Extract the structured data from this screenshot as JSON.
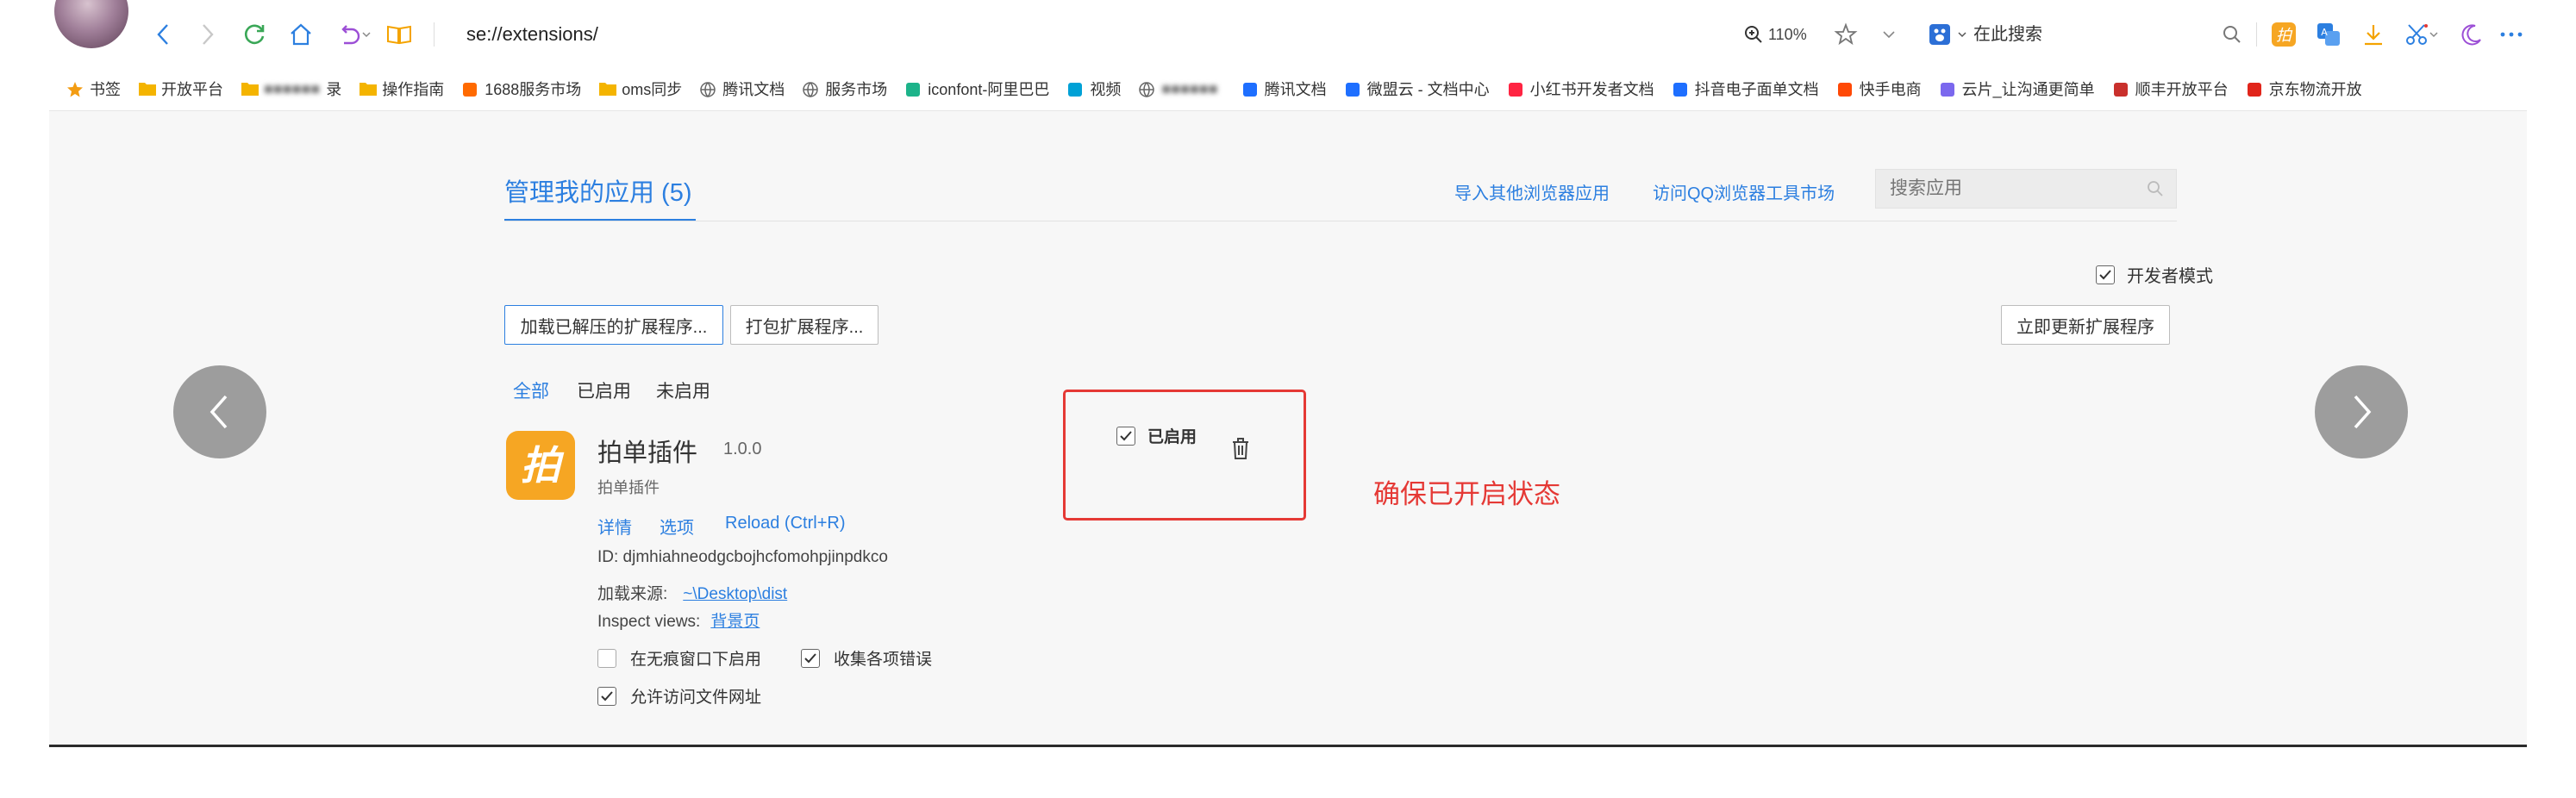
{
  "browser": {
    "url": "se://extensions/",
    "zoom": "110%",
    "search_engine_label": "在此搜索"
  },
  "bookmarks": [
    {
      "label": "书签",
      "icon": "star-icon",
      "color": "#f39c12"
    },
    {
      "label": "开放平台",
      "icon": "folder-icon",
      "color": "#f4b400"
    },
    {
      "label": "录",
      "icon": "folder-icon",
      "color": "#f4b400",
      "blurred": true
    },
    {
      "label": "操作指南",
      "icon": "folder-icon",
      "color": "#f4b400"
    },
    {
      "label": "1688服务市场",
      "icon": "1688-icon",
      "color": "#ff6a00"
    },
    {
      "label": "oms同步",
      "icon": "folder-icon",
      "color": "#f4b400"
    },
    {
      "label": "腾讯文档",
      "icon": "globe-icon",
      "color": "#666666"
    },
    {
      "label": "服务市场",
      "icon": "globe-icon",
      "color": "#666666"
    },
    {
      "label": "iconfont-阿里巴巴",
      "icon": "iconfont-icon",
      "color": "#1db38a"
    },
    {
      "label": "视频",
      "icon": "bilibili-icon",
      "color": "#00a1d6"
    },
    {
      "label": "",
      "icon": "globe-icon",
      "color": "#666666",
      "blurred": true
    },
    {
      "label": "腾讯文档",
      "icon": "tencent-docs-icon",
      "color": "#1e6fff"
    },
    {
      "label": "微盟云 - 文档中心",
      "icon": "weimob-icon",
      "color": "#1e6fff"
    },
    {
      "label": "小红书开发者文档",
      "icon": "xiaohongshu-icon",
      "color": "#ff2442"
    },
    {
      "label": "抖音电子面单文档",
      "icon": "doc-icon",
      "color": "#1e6fff"
    },
    {
      "label": "快手电商",
      "icon": "kuaishou-icon",
      "color": "#ff4906"
    },
    {
      "label": "云片_让沟通更简单",
      "icon": "yunpian-icon",
      "color": "#7b68ee"
    },
    {
      "label": "顺丰开放平台",
      "icon": "sf-icon",
      "color": "#c9302c"
    },
    {
      "label": "京东物流开放",
      "icon": "jd-icon",
      "color": "#e1251b"
    }
  ],
  "page": {
    "title": "管理我的应用 (5)",
    "import_link": "导入其他浏览器应用",
    "store_link": "访问QQ浏览器工具市场",
    "search_placeholder": "搜索应用",
    "dev_mode_label": "开发者模式",
    "dev_mode_checked": true,
    "load_unpacked_button": "加载已解压的扩展程序...",
    "pack_button": "打包扩展程序...",
    "update_button": "立即更新扩展程序",
    "filters": [
      {
        "label": "全部",
        "active": true
      },
      {
        "label": "已启用",
        "active": false
      },
      {
        "label": "未启用",
        "active": false
      }
    ],
    "accent_color": "#2c7fe0"
  },
  "extension": {
    "name": "拍单插件",
    "version": "1.0.0",
    "description": "拍单插件",
    "links": {
      "details": "详情",
      "options": "选项",
      "reload": "Reload (Ctrl+R)"
    },
    "id_text": "ID: djmhiahneodgcbojhcfomohpjinpdkco",
    "source_label": "加载来源:",
    "source_path": "~\\Desktop\\dist",
    "inspect_label": "Inspect views:",
    "inspect_link": "背景页",
    "enabled_label": "已启用",
    "enabled": true,
    "incognito_label": "在无痕窗口下启用",
    "incognito_checked": false,
    "collect_errors_label": "收集各项错误",
    "collect_errors_checked": true,
    "file_access_label": "允许访问文件网址",
    "file_access_checked": true,
    "icon_color": "#f6a623",
    "icon_glyph": "拍"
  },
  "annotation": {
    "text": "确保已开启状态",
    "color": "#e53935"
  }
}
